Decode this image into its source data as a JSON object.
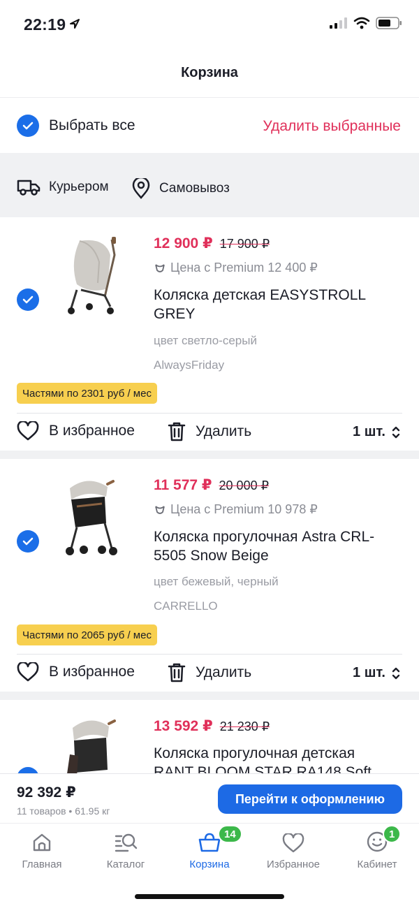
{
  "status": {
    "time": "22:19"
  },
  "header": {
    "title": "Корзина"
  },
  "selection": {
    "select_all": "Выбрать все",
    "delete_selected": "Удалить выбранные"
  },
  "delivery": {
    "courier": "Курьером",
    "pickup": "Самовывоз"
  },
  "products": [
    {
      "price": "12 900 ₽",
      "old_price": "17 900 ₽",
      "premium": "Цена с Premium 12 400 ₽",
      "name": "Коляска детская EASYSTROLL GREY",
      "color": "цвет светло-серый",
      "brand": "AlwaysFriday",
      "installment": "Частями по 2301 руб / мес",
      "favorite": "В избранное",
      "delete": "Удалить",
      "qty": "1 шт."
    },
    {
      "price": "11 577 ₽",
      "old_price": "20 000 ₽",
      "premium": "Цена с Premium 10 978 ₽",
      "name": "Коляска прогулочная Astra CRL-5505 Snow Beige",
      "color": "цвет бежевый, черный",
      "brand": "CARRELLO",
      "installment": "Частями по 2065 руб / мес",
      "favorite": "В избранное",
      "delete": "Удалить",
      "qty": "1 шт."
    },
    {
      "price": "13 592 ₽",
      "old_price": "21 230 ₽",
      "name": "Коляска прогулочная детская RANT BLOOM STAR RA148 Soft"
    }
  ],
  "checkout": {
    "total": "92 392 ₽",
    "summary": "11 товаров • 61.95 кг",
    "button": "Перейти к оформлению"
  },
  "tabs": [
    {
      "label": "Главная",
      "icon": "home-icon"
    },
    {
      "label": "Каталог",
      "icon": "catalog-search-icon"
    },
    {
      "label": "Корзина",
      "icon": "basket-icon",
      "badge": "14",
      "active": true
    },
    {
      "label": "Избранное",
      "icon": "heart-icon"
    },
    {
      "label": "Кабинет",
      "icon": "smiley-profile-icon",
      "badge": "1"
    }
  ],
  "colors": {
    "accent": "#1d6ae5",
    "sale": "#e0305a",
    "installment": "#f7cf4f",
    "badge": "#3cb84a"
  }
}
